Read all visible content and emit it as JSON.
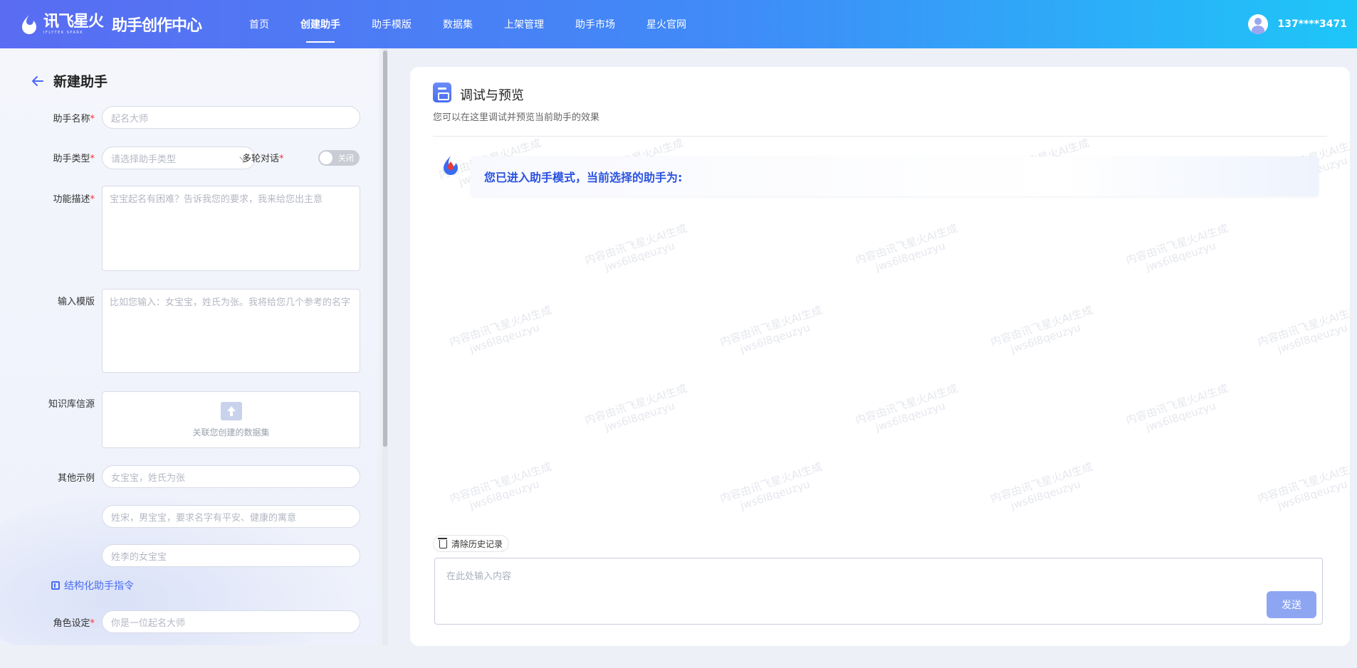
{
  "header": {
    "brand": "讯飞星火",
    "brand_sub": "IFLYTEK SPARK",
    "title": "助手创作中心",
    "nav": [
      {
        "label": "首页"
      },
      {
        "label": "创建助手"
      },
      {
        "label": "助手模版"
      },
      {
        "label": "数据集"
      },
      {
        "label": "上架管理"
      },
      {
        "label": "助手市场"
      },
      {
        "label": "星火官网"
      }
    ],
    "active_nav": "创建助手",
    "username": "137****3471"
  },
  "form": {
    "page_title": "新建助手",
    "name_label": "助手名称",
    "name_placeholder": "起名大师",
    "type_label": "助手类型",
    "type_placeholder": "请选择助手类型",
    "multi_label": "多轮对话",
    "multi_toggle": "关闭",
    "desc_label": "功能描述",
    "desc_placeholder": "宝宝起名有困难？告诉我您的要求，我来给您出主意",
    "template_label": "输入模版",
    "template_placeholder": "比如您输入：女宝宝，姓氏为张。我将给您几个参考的名字",
    "kb_label": "知识库信源",
    "kb_text": "关联您创建的数据集",
    "examples_label": "其他示例",
    "examples": [
      "女宝宝，姓氏为张",
      "姓宋，男宝宝，要求名字有平安、健康的寓意",
      "姓李的女宝宝"
    ],
    "struct_label": "结构化助手指令",
    "role_label": "角色设定",
    "role_placeholder": "你是一位起名大师",
    "required_mark": "*"
  },
  "preview": {
    "title": "调试与预览",
    "subtitle": "您可以在这里调试并预览当前助手的效果",
    "bot_message": "您已进入助手模式，当前选择的助手为:",
    "watermark_line1": "内容由讯飞星火AI生成",
    "watermark_line2": "jws6l8qeuzyu",
    "clear_label": "清除历史记录",
    "input_placeholder": "在此处输入内容",
    "send_label": "发送"
  },
  "colors": {
    "accent": "#4a6cf0",
    "send_button": "#8ea6f2",
    "required": "#e33333"
  },
  "icons": [
    "iflytek-logo-icon",
    "user-avatar-icon",
    "back-arrow-icon",
    "chevron-down-icon",
    "upload-icon",
    "document-icon",
    "assistant-bot-icon",
    "trash-icon"
  ]
}
